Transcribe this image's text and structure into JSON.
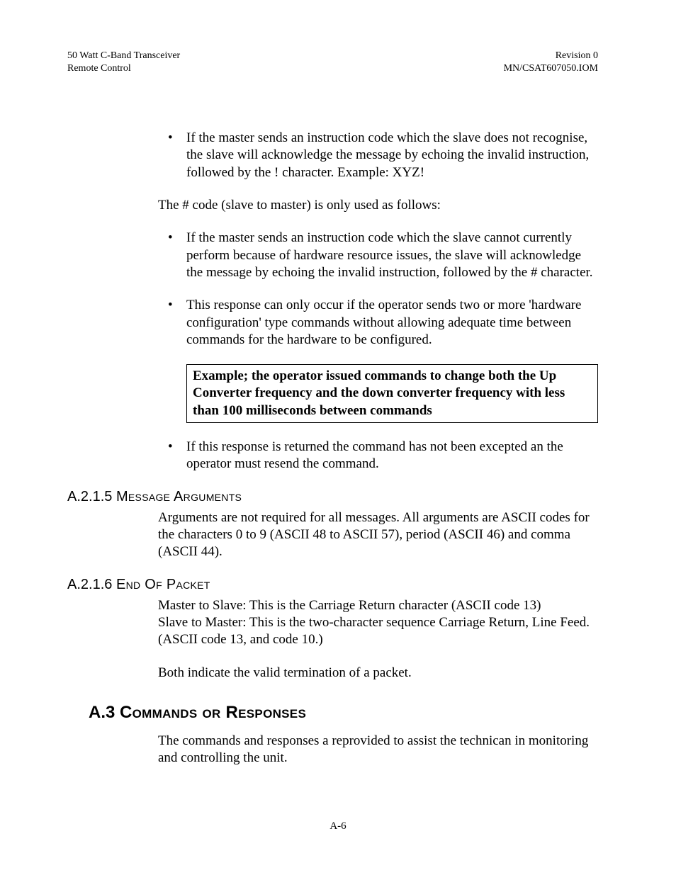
{
  "header": {
    "left_line1": "50 Watt C-Band Transceiver",
    "left_line2": "Remote Control",
    "right_line1": "Revision 0",
    "right_line2": "MN/CSAT607050.IOM"
  },
  "content": {
    "bullet_a1": "If the master sends an instruction code which the slave does not recognise, the slave will acknowledge the message by echoing the invalid instruction, followed by the ! character. Example: XYZ!",
    "para_hash_intro": "The # code (slave to master) is only used as follows:",
    "bullet_b1": "If the master sends an instruction code which the slave cannot currently perform because of hardware resource issues, the slave will acknowledge the message by echoing the invalid instruction, followed by the # character.",
    "bullet_b2": "This response can only occur if the operator sends two or more 'hardware configuration' type commands without allowing adequate time between commands for the hardware to be configured.",
    "example_box": "Example; the operator issued commands to change both the Up Converter frequency and the down converter frequency with less than 100 milliseconds between commands",
    "bullet_b3": " If this response is returned the command has not been excepted an the operator must resend the command.",
    "sec_a215": {
      "num": "A.2.1.5",
      "title": "Message Arguments",
      "para": "Arguments are not required for all messages.  All arguments are ASCII codes for the characters 0 to 9 (ASCII 48 to ASCII 57), period (ASCII 46) and comma (ASCII 44)."
    },
    "sec_a216": {
      "num": "A.2.1.6",
      "title": "End Of Packet",
      "para1": "Master to Slave: This is the Carriage Return character (ASCII code 13)",
      "para2": "Slave to Master: This is the two-character sequence Carriage Return, Line Feed. (ASCII code 13, and code 10.)",
      "para3": "Both indicate the valid termination of a packet."
    },
    "sec_a3": {
      "num": "A.3",
      "title": "Commands or Responses",
      "para": "The commands and responses a reprovided to assist the technican in monitoring and controlling the unit."
    }
  },
  "footer": {
    "page_number": "A-6"
  }
}
